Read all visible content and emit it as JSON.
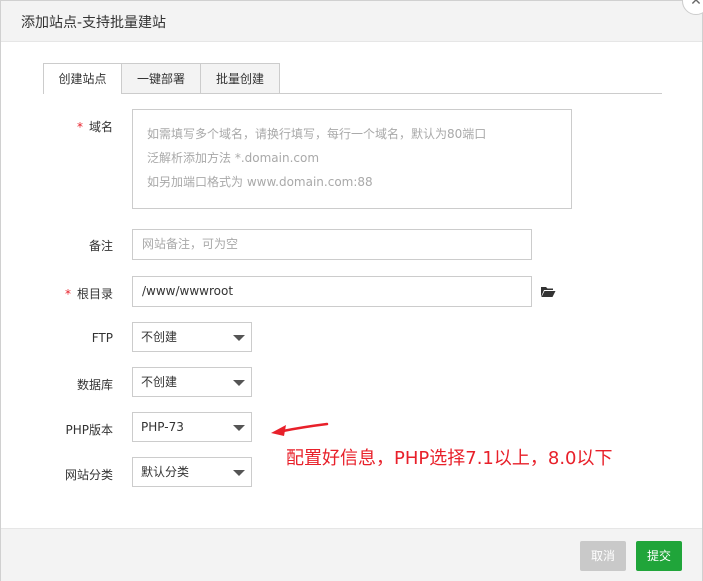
{
  "dialog": {
    "title": "添加站点-支持批量建站",
    "close_icon": "close-icon"
  },
  "tabs": [
    {
      "label": "创建站点",
      "active": true
    },
    {
      "label": "一键部署",
      "active": false
    },
    {
      "label": "批量创建",
      "active": false
    }
  ],
  "form": {
    "domain": {
      "label": "域名",
      "required_mark": "*",
      "placeholder_lines": [
        "如需填写多个域名，请换行填写，每行一个域名，默认为80端口",
        "泛解析添加方法 *.domain.com",
        "如另加端口格式为 www.domain.com:88"
      ]
    },
    "remark": {
      "label": "备注",
      "placeholder": "网站备注，可为空"
    },
    "root_dir": {
      "label": "根目录",
      "required_mark": "*",
      "value": "/www/wwwroot",
      "icon": "folder-open-icon"
    },
    "ftp": {
      "label": "FTP",
      "value": "不创建"
    },
    "database": {
      "label": "数据库",
      "value": "不创建"
    },
    "php_version": {
      "label": "PHP版本",
      "value": "PHP-73"
    },
    "site_category": {
      "label": "网站分类",
      "value": "默认分类"
    }
  },
  "annotation": {
    "text": "配置好信息，PHP选择7.1以上，8.0以下",
    "color": "#e8202a"
  },
  "footer": {
    "cancel_label": "取消",
    "submit_label": "提交"
  },
  "colors": {
    "accent": "#20a53a",
    "required": "#e8202a"
  }
}
